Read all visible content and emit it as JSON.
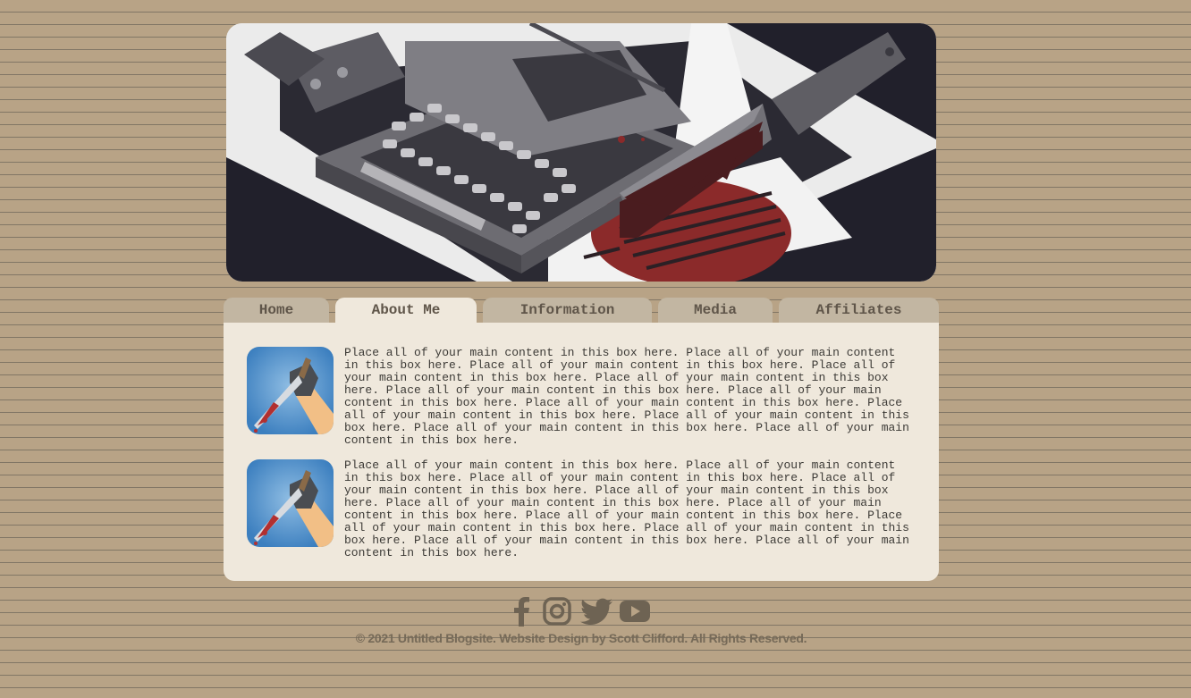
{
  "nav": {
    "tabs": [
      {
        "label": "Home"
      },
      {
        "label": "About Me"
      },
      {
        "label": "Information"
      },
      {
        "label": "Media"
      },
      {
        "label": "Affiliates"
      }
    ],
    "active": "About Me"
  },
  "posts": [
    {
      "text": "Place all of your main content in this box here. Place all of your main content in this box here. Place all of your main content in this box here. Place all of your main content in this box here. Place all of your main content in this box here. Place all of your main content in this box here. Place all of your main content in this box here. Place all of your main content in this box here. Place all of your main content in this box here. Place all of your main content in this box here. Place all of your main content in this box here. Place all of your main content in this box here."
    },
    {
      "text": "Place all of your main content in this box here. Place all of your main content in this box here. Place all of your main content in this box here. Place all of your main content in this box here. Place all of your main content in this box here. Place all of your main content in this box here. Place all of your main content in this box here. Place all of your main content in this box here. Place all of your main content in this box here. Place all of your main content in this box here. Place all of your main content in this box here. Place all of your main content in this box here."
    }
  ],
  "social": [
    "facebook-icon",
    "instagram-icon",
    "twitter-icon",
    "youtube-icon"
  ],
  "footer": {
    "copyright": "© 2021 Untitled Blogsite. Website Design by Scott Clifford. All Rights Reserved."
  },
  "colors": {
    "background": "#b8a386",
    "content_box": "#efe8dc",
    "tab": "#c2b6a2",
    "icon": "#6e6353",
    "blood": "#8b2a2a"
  }
}
